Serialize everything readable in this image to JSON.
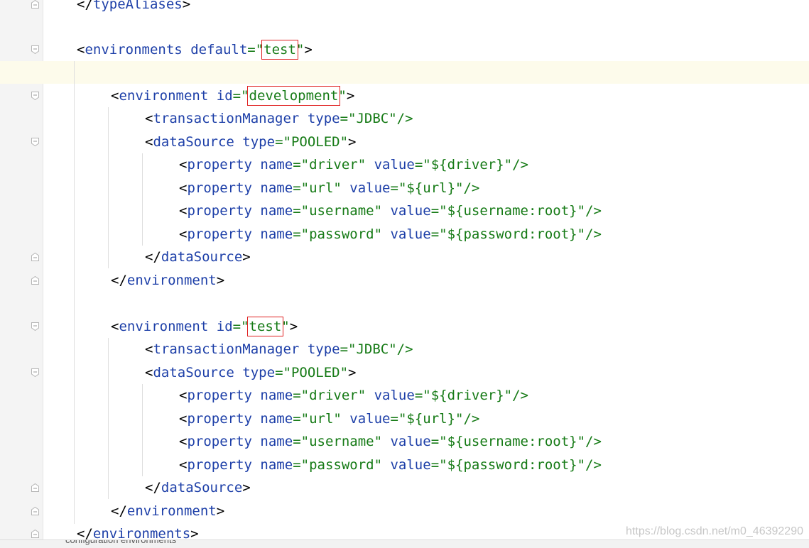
{
  "code": {
    "l0": {
      "close_open": "</",
      "tag": "typeAliases",
      "close": ">"
    },
    "l2": {
      "open": "<",
      "tag": "environments",
      "attr": "default",
      "eq": "=\"",
      "val": "test",
      "q": "\"",
      "close": ">"
    },
    "l4": {
      "open": "<",
      "tag": "environment",
      "attr": "id",
      "eq": "=\"",
      "val": "development",
      "q": "\"",
      "close": ">"
    },
    "l5": {
      "open": "<",
      "tag": "transactionManager",
      "attr": "type",
      "eq": "=\"",
      "val": "JDBC",
      "end": "\"/>"
    },
    "l6": {
      "open": "<",
      "tag": "dataSource",
      "attr": "type",
      "eq": "=\"",
      "val": "POOLED",
      "q": "\"",
      "close": ">"
    },
    "l7": {
      "open": "<",
      "tag": "property",
      "a1": "name",
      "eq1": "=\"",
      "v1": "driver",
      "q1": "\" ",
      "a2": "value",
      "eq2": "=\"",
      "v2": "${driver}",
      "end": "\"/>"
    },
    "l8": {
      "open": "<",
      "tag": "property",
      "a1": "name",
      "eq1": "=\"",
      "v1": "url",
      "q1": "\" ",
      "a2": "value",
      "eq2": "=\"",
      "v2": "${url}",
      "end": "\"/>"
    },
    "l9": {
      "open": "<",
      "tag": "property",
      "a1": "name",
      "eq1": "=\"",
      "v1": "username",
      "q1": "\" ",
      "a2": "value",
      "eq2": "=\"",
      "v2": "${username:root}",
      "end": "\"/>"
    },
    "l10": {
      "open": "<",
      "tag": "property",
      "a1": "name",
      "eq1": "=\"",
      "v1": "password",
      "q1": "\" ",
      "a2": "value",
      "eq2": "=\"",
      "v2": "${password:root}",
      "end": "\"/>"
    },
    "l11": {
      "close_open": "</",
      "tag": "dataSource",
      "close": ">"
    },
    "l12": {
      "close_open": "</",
      "tag": "environment",
      "close": ">"
    },
    "l14": {
      "open": "<",
      "tag": "environment",
      "attr": "id",
      "eq": "=\"",
      "val": "test",
      "q": "\"",
      "close": ">"
    },
    "l15": {
      "open": "<",
      "tag": "transactionManager",
      "attr": "type",
      "eq": "=\"",
      "val": "JDBC",
      "end": "\"/>"
    },
    "l16": {
      "open": "<",
      "tag": "dataSource",
      "attr": "type",
      "eq": "=\"",
      "val": "POOLED",
      "q": "\"",
      "close": ">"
    },
    "l17": {
      "open": "<",
      "tag": "property",
      "a1": "name",
      "eq1": "=\"",
      "v1": "driver",
      "q1": "\" ",
      "a2": "value",
      "eq2": "=\"",
      "v2": "${driver}",
      "end": "\"/>"
    },
    "l18": {
      "open": "<",
      "tag": "property",
      "a1": "name",
      "eq1": "=\"",
      "v1": "url",
      "q1": "\" ",
      "a2": "value",
      "eq2": "=\"",
      "v2": "${url}",
      "end": "\"/>"
    },
    "l19": {
      "open": "<",
      "tag": "property",
      "a1": "name",
      "eq1": "=\"",
      "v1": "username",
      "q1": "\" ",
      "a2": "value",
      "eq2": "=\"",
      "v2": "${username:root}",
      "end": "\"/>"
    },
    "l20": {
      "open": "<",
      "tag": "property",
      "a1": "name",
      "eq1": "=\"",
      "v1": "password",
      "q1": "\" ",
      "a2": "value",
      "eq2": "=\"",
      "v2": "${password:root}",
      "end": "\"/>"
    },
    "l21": {
      "close_open": "</",
      "tag": "dataSource",
      "close": ">"
    },
    "l22": {
      "close_open": "</",
      "tag": "environment",
      "close": ">"
    },
    "l23": {
      "close_open": "</",
      "tag": "environments",
      "close": ">"
    }
  },
  "breadcrumb": "configuration   environments",
  "watermark": "https://blog.csdn.net/m0_46392290",
  "colors": {
    "tag": "#1d3fa8",
    "value": "#157a15",
    "highlight_box": "#e02020",
    "caret_row": "#fdfbeb"
  }
}
